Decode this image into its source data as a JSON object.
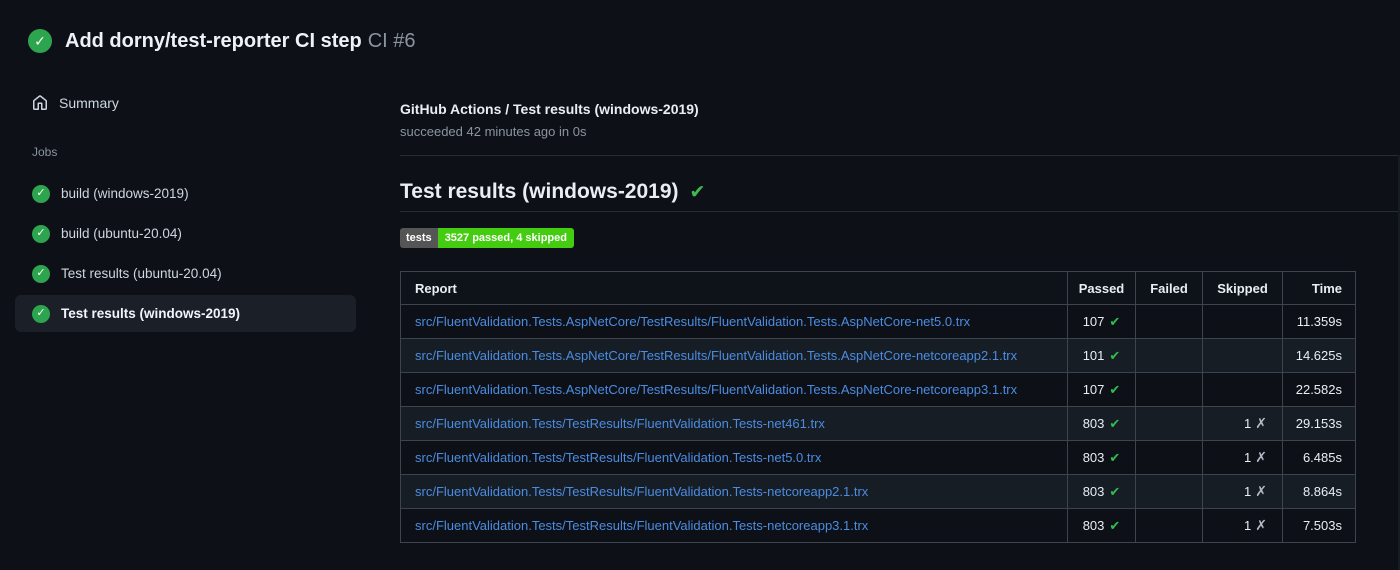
{
  "header": {
    "title": "Add dorny/test-reporter CI step",
    "run_number": "CI #6"
  },
  "sidebar": {
    "summary_label": "Summary",
    "jobs_section_label": "Jobs",
    "jobs": [
      {
        "label": "build (windows-2019)",
        "selected": false
      },
      {
        "label": "build (ubuntu-20.04)",
        "selected": false
      },
      {
        "label": "Test results (ubuntu-20.04)",
        "selected": false
      },
      {
        "label": "Test results (windows-2019)",
        "selected": true
      }
    ]
  },
  "main": {
    "breadcrumb": "GitHub Actions / Test results (windows-2019)",
    "status_line": "succeeded 42 minutes ago in 0s",
    "section_title": "Test results (windows-2019)",
    "badge": {
      "label": "tests",
      "value": "3527 passed, 4 skipped",
      "label_bg": "#555555",
      "value_bg": "#44cc11"
    },
    "table": {
      "columns": [
        "Report",
        "Passed",
        "Failed",
        "Skipped",
        "Time"
      ],
      "rows": [
        {
          "report": "src/FluentValidation.Tests.AspNetCore/TestResults/FluentValidation.Tests.AspNetCore-net5.0.trx",
          "passed": "107",
          "passed_icon": "✔",
          "failed": "",
          "skipped": "",
          "skipped_icon": "",
          "time": "11.359s"
        },
        {
          "report": "src/FluentValidation.Tests.AspNetCore/TestResults/FluentValidation.Tests.AspNetCore-netcoreapp2.1.trx",
          "passed": "101",
          "passed_icon": "✔",
          "failed": "",
          "skipped": "",
          "skipped_icon": "",
          "time": "14.625s"
        },
        {
          "report": "src/FluentValidation.Tests.AspNetCore/TestResults/FluentValidation.Tests.AspNetCore-netcoreapp3.1.trx",
          "passed": "107",
          "passed_icon": "✔",
          "failed": "",
          "skipped": "",
          "skipped_icon": "",
          "time": "22.582s"
        },
        {
          "report": "src/FluentValidation.Tests/TestResults/FluentValidation.Tests-net461.trx",
          "passed": "803",
          "passed_icon": "✔",
          "failed": "",
          "skipped": "1",
          "skipped_icon": "✗",
          "time": "29.153s"
        },
        {
          "report": "src/FluentValidation.Tests/TestResults/FluentValidation.Tests-net5.0.trx",
          "passed": "803",
          "passed_icon": "✔",
          "failed": "",
          "skipped": "1",
          "skipped_icon": "✗",
          "time": "6.485s"
        },
        {
          "report": "src/FluentValidation.Tests/TestResults/FluentValidation.Tests-netcoreapp2.1.trx",
          "passed": "803",
          "passed_icon": "✔",
          "failed": "",
          "skipped": "1",
          "skipped_icon": "✗",
          "time": "8.864s"
        },
        {
          "report": "src/FluentValidation.Tests/TestResults/FluentValidation.Tests-netcoreapp3.1.trx",
          "passed": "803",
          "passed_icon": "✔",
          "failed": "",
          "skipped": "1",
          "skipped_icon": "✗",
          "time": "7.503s"
        }
      ]
    }
  },
  "icons": {
    "circle_check": "✓",
    "heading_check": "✔",
    "home": "house-outline"
  },
  "colors": {
    "background": "#0d1117",
    "success_circle": "#2da44e",
    "check_green": "#2fbf4f",
    "cross_gray": "#b4bcc6",
    "link_blue": "#4b8ce1",
    "badge_label_bg": "#555555",
    "badge_value_bg": "#44cc11",
    "selected_item_bg": "#1b2028"
  }
}
